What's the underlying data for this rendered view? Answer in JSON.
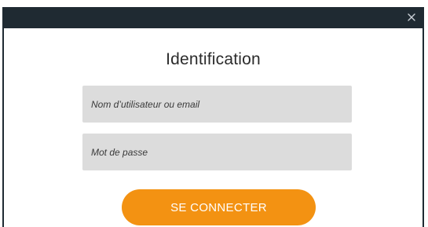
{
  "dialog": {
    "title": "Identification",
    "close_icon": "close-icon",
    "username_placeholder": "Nom d’utilisateur ou email",
    "username_value": "",
    "password_placeholder": "Mot de passe",
    "password_value": "",
    "submit_label": "SE CONNECTER"
  },
  "colors": {
    "titlebar": "#1f2a32",
    "input_background": "#dcdcdc",
    "accent": "#f39212"
  }
}
